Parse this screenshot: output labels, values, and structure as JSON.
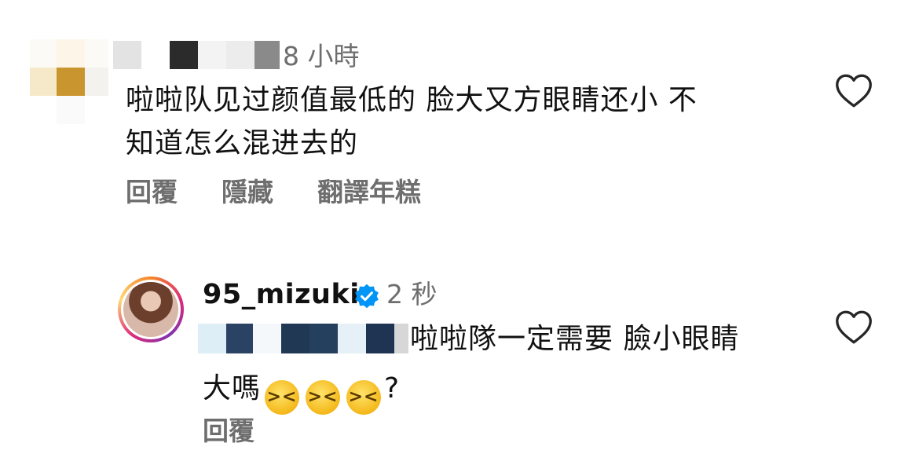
{
  "comment1": {
    "time": "8 小時",
    "text_line1": "啦啦队见过颜值最低的 脸大又方眼睛还小 不",
    "text_line2": "知道怎么混进去的",
    "actions": {
      "reply": "回覆",
      "hide": "隱藏",
      "translate": "翻譯年糕"
    }
  },
  "comment2": {
    "username": "95_mizuki",
    "verified_icon": "verified-badge-icon",
    "time": "2 秒",
    "text_line1": "啦啦隊一定需要 臉小眼睛",
    "text_line2_prefix": "大嗎",
    "emoji": "😆",
    "text_suffix": "?",
    "actions": {
      "reply": "回覆"
    }
  },
  "colors": {
    "meta_gray": "#6e6e6e",
    "verified_blue": "#0095f6",
    "text": "#111111"
  }
}
